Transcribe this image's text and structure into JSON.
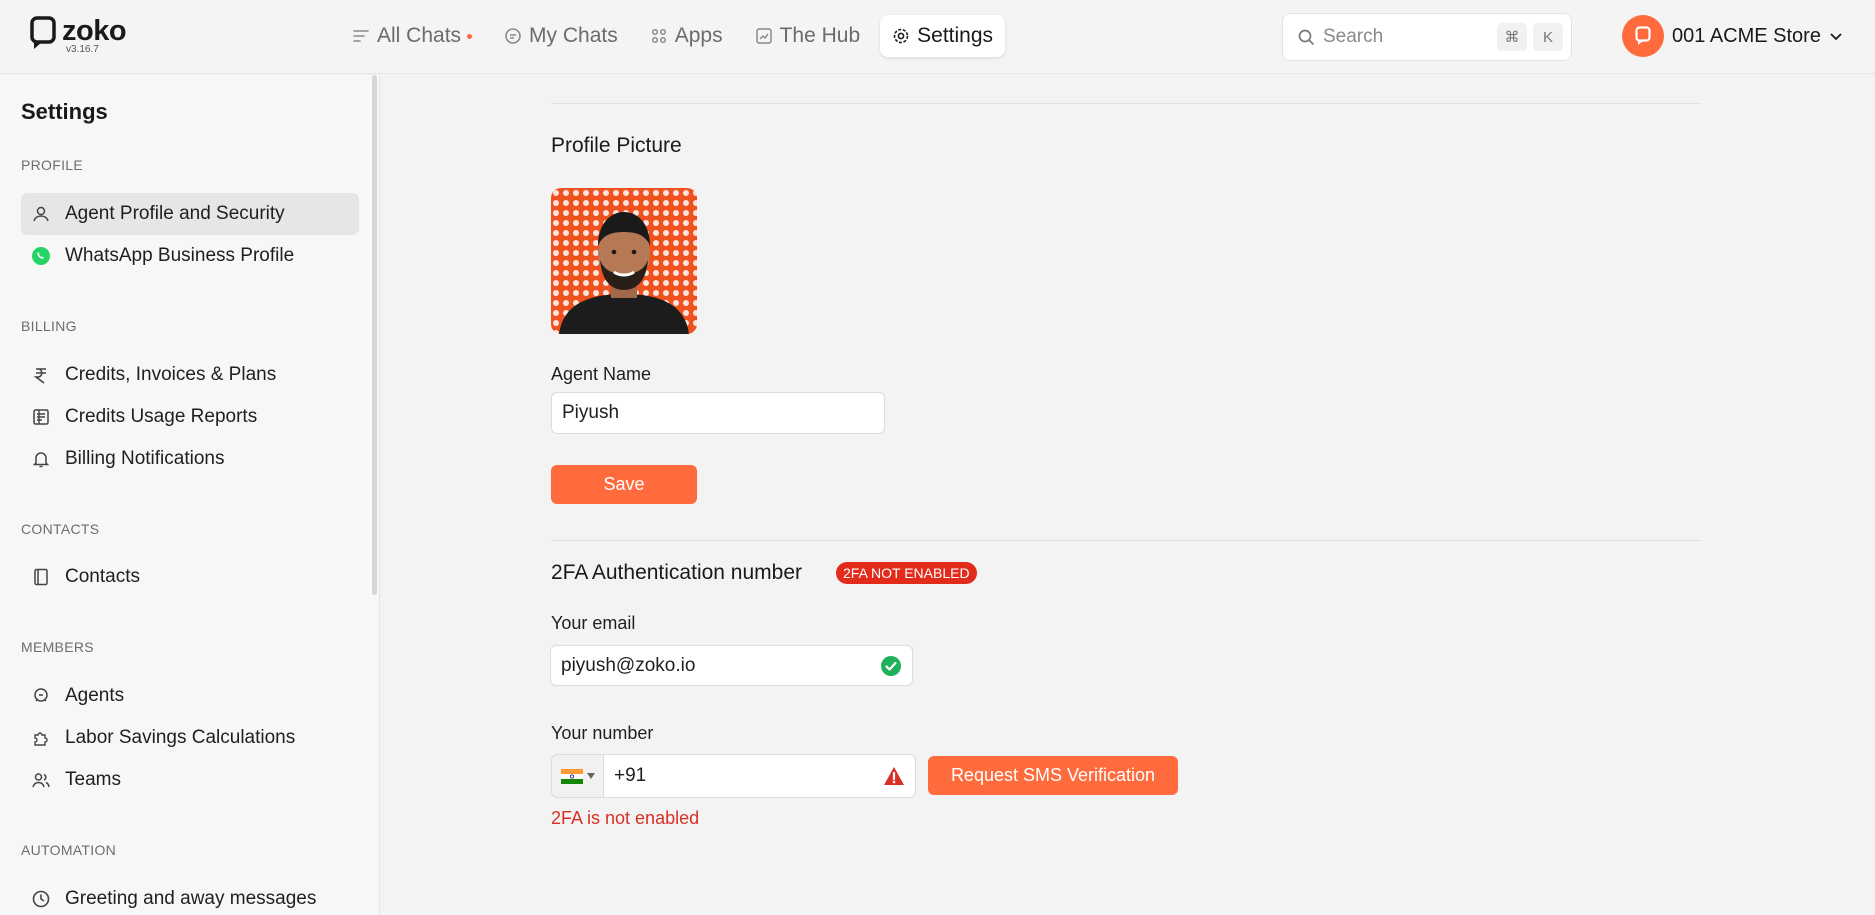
{
  "app": {
    "logo_text": "zoko",
    "version": "v3.16.7"
  },
  "nav": {
    "all_chats": "All Chats",
    "my_chats": "My Chats",
    "apps": "Apps",
    "hub": "The Hub",
    "settings": "Settings"
  },
  "search": {
    "placeholder": "Search",
    "shortcut_mod": "⌘",
    "shortcut_key": "K"
  },
  "account": {
    "name": "001 ACME Store"
  },
  "sidebar": {
    "title": "Settings",
    "sections": {
      "profile": "PROFILE",
      "billing": "BILLING",
      "contacts": "CONTACTS",
      "members": "MEMBERS",
      "automation": "AUTOMATION"
    },
    "items": {
      "agent_profile": "Agent Profile and Security",
      "whatsapp_profile": "WhatsApp Business Profile",
      "credits": "Credits, Invoices & Plans",
      "usage": "Credits Usage Reports",
      "billing_notifications": "Billing Notifications",
      "contacts": "Contacts",
      "agents": "Agents",
      "labor": "Labor Savings Calculations",
      "teams": "Teams",
      "greeting": "Greeting and away messages"
    }
  },
  "main": {
    "profile_picture_heading": "Profile Picture",
    "agent_name_label": "Agent Name",
    "agent_name_value": "Piyush",
    "save_label": "Save",
    "twofa_heading": "2FA Authentication number",
    "twofa_badge": "2FA NOT ENABLED",
    "email_label": "Your email",
    "email_value": "piyush@zoko.io",
    "number_label": "Your number",
    "number_value": "+91",
    "request_sms_label": "Request SMS Verification",
    "error_text": "2FA is not enabled"
  },
  "colors": {
    "accent": "#ff6b3d",
    "error": "#d93026",
    "badge": "#e32b1c",
    "success": "#1fb05b"
  }
}
